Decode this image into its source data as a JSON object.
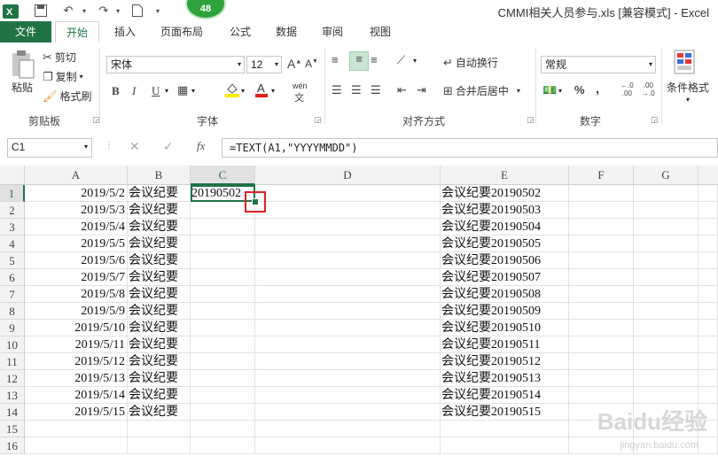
{
  "window": {
    "title": "CMMI相关人员参与.xls  [兼容模式] - Excel",
    "badge": "48"
  },
  "tabs": [
    {
      "label": "文件"
    },
    {
      "label": "开始"
    },
    {
      "label": "插入"
    },
    {
      "label": "页面布局"
    },
    {
      "label": "公式"
    },
    {
      "label": "数据"
    },
    {
      "label": "审阅"
    },
    {
      "label": "视图"
    }
  ],
  "ribbon": {
    "clipboard": {
      "label": "剪贴板",
      "paste": "粘贴",
      "cut": "剪切",
      "copy": "复制",
      "format_painter": "格式刷"
    },
    "font": {
      "label": "字体",
      "name": "宋体",
      "size": "12",
      "bold": "B",
      "italic": "I",
      "underline": "U",
      "pinyin": "wén"
    },
    "alignment": {
      "label": "对齐方式",
      "wrap": "自动换行",
      "merge": "合并后居中"
    },
    "number": {
      "label": "数字",
      "format": "常规",
      "percent": "%",
      "comma": ","
    },
    "styles": {
      "conditional": "条件格式"
    }
  },
  "formula_bar": {
    "name_box": "C1",
    "formula": "=TEXT(A1,\"YYYYMMDD\")",
    "fx": "fx"
  },
  "columns": [
    "A",
    "B",
    "C",
    "D",
    "E",
    "F",
    "G"
  ],
  "rows": [
    {
      "n": "1",
      "a": "2019/5/2",
      "b": "会议纪要",
      "c": "20190502",
      "e": "会议纪要20190502"
    },
    {
      "n": "2",
      "a": "2019/5/3",
      "b": "会议纪要",
      "c": "",
      "e": "会议纪要20190503"
    },
    {
      "n": "3",
      "a": "2019/5/4",
      "b": "会议纪要",
      "c": "",
      "e": "会议纪要20190504"
    },
    {
      "n": "4",
      "a": "2019/5/5",
      "b": "会议纪要",
      "c": "",
      "e": "会议纪要20190505"
    },
    {
      "n": "5",
      "a": "2019/5/6",
      "b": "会议纪要",
      "c": "",
      "e": "会议纪要20190506"
    },
    {
      "n": "6",
      "a": "2019/5/7",
      "b": "会议纪要",
      "c": "",
      "e": "会议纪要20190507"
    },
    {
      "n": "7",
      "a": "2019/5/8",
      "b": "会议纪要",
      "c": "",
      "e": "会议纪要20190508"
    },
    {
      "n": "8",
      "a": "2019/5/9",
      "b": "会议纪要",
      "c": "",
      "e": "会议纪要20190509"
    },
    {
      "n": "9",
      "a": "2019/5/10",
      "b": "会议纪要",
      "c": "",
      "e": "会议纪要20190510"
    },
    {
      "n": "10",
      "a": "2019/5/11",
      "b": "会议纪要",
      "c": "",
      "e": "会议纪要20190511"
    },
    {
      "n": "11",
      "a": "2019/5/12",
      "b": "会议纪要",
      "c": "",
      "e": "会议纪要20190512"
    },
    {
      "n": "12",
      "a": "2019/5/13",
      "b": "会议纪要",
      "c": "",
      "e": "会议纪要20190513"
    },
    {
      "n": "13",
      "a": "2019/5/14",
      "b": "会议纪要",
      "c": "",
      "e": "会议纪要20190514"
    },
    {
      "n": "14",
      "a": "2019/5/15",
      "b": "会议纪要",
      "c": "",
      "e": "会议纪要20190515"
    },
    {
      "n": "15",
      "a": "",
      "b": "",
      "c": "",
      "e": ""
    },
    {
      "n": "16",
      "a": "",
      "b": "",
      "c": "",
      "e": ""
    }
  ],
  "watermark": {
    "brand": "Baidu经验",
    "url": "jingyan.baidu.com"
  },
  "colors": {
    "excel_green": "#217346",
    "highlight_red": "#e02020"
  }
}
